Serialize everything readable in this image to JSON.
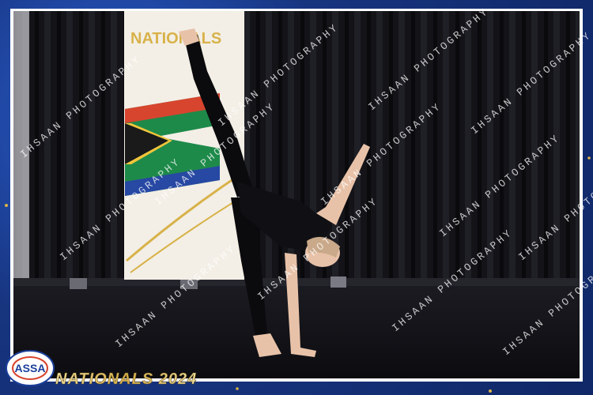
{
  "banner": {
    "text": "NATIONALS"
  },
  "event_title": "NATIONALS 2024",
  "logo": {
    "text": "ASSA"
  },
  "watermark": {
    "text": "IHSAAN PHOTOGRAPHY"
  },
  "colors": {
    "frame_blue": "#1c3f9a",
    "border_white": "#ffffff",
    "gold": "#d8b24a",
    "stage_black": "#0d0d10",
    "curtain": "#141418",
    "skin": "#e8c2a8",
    "flag_red": "#d8452e",
    "flag_green": "#1e8a4a",
    "flag_blue": "#2748a3",
    "flag_yellow": "#f1c43b"
  }
}
